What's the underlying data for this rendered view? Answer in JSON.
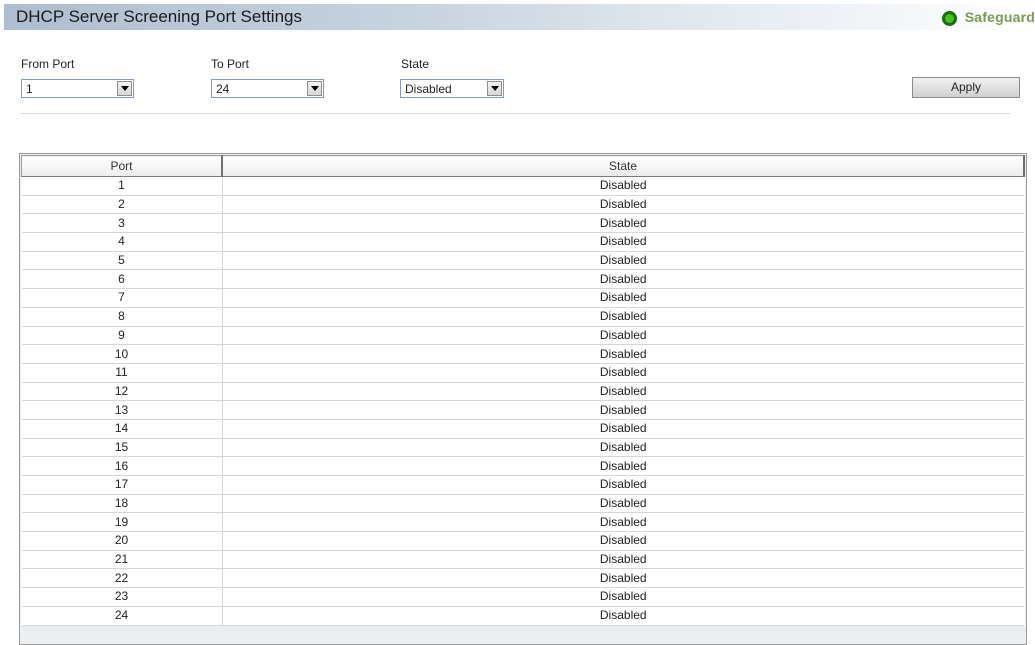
{
  "header": {
    "title": "DHCP Server Screening Port Settings",
    "safeguard_label": "Safeguard",
    "safeguard_status_color": "#45c41f"
  },
  "form": {
    "from_port": {
      "label": "From Port",
      "value": "1"
    },
    "to_port": {
      "label": "To Port",
      "value": "24"
    },
    "state": {
      "label": "State",
      "value": "Disabled"
    },
    "apply_label": "Apply"
  },
  "table": {
    "columns": [
      "Port",
      "State"
    ],
    "rows": [
      {
        "port": "1",
        "state": "Disabled"
      },
      {
        "port": "2",
        "state": "Disabled"
      },
      {
        "port": "3",
        "state": "Disabled"
      },
      {
        "port": "4",
        "state": "Disabled"
      },
      {
        "port": "5",
        "state": "Disabled"
      },
      {
        "port": "6",
        "state": "Disabled"
      },
      {
        "port": "7",
        "state": "Disabled"
      },
      {
        "port": "8",
        "state": "Disabled"
      },
      {
        "port": "9",
        "state": "Disabled"
      },
      {
        "port": "10",
        "state": "Disabled"
      },
      {
        "port": "11",
        "state": "Disabled"
      },
      {
        "port": "12",
        "state": "Disabled"
      },
      {
        "port": "13",
        "state": "Disabled"
      },
      {
        "port": "14",
        "state": "Disabled"
      },
      {
        "port": "15",
        "state": "Disabled"
      },
      {
        "port": "16",
        "state": "Disabled"
      },
      {
        "port": "17",
        "state": "Disabled"
      },
      {
        "port": "18",
        "state": "Disabled"
      },
      {
        "port": "19",
        "state": "Disabled"
      },
      {
        "port": "20",
        "state": "Disabled"
      },
      {
        "port": "21",
        "state": "Disabled"
      },
      {
        "port": "22",
        "state": "Disabled"
      },
      {
        "port": "23",
        "state": "Disabled"
      },
      {
        "port": "24",
        "state": "Disabled"
      }
    ]
  }
}
